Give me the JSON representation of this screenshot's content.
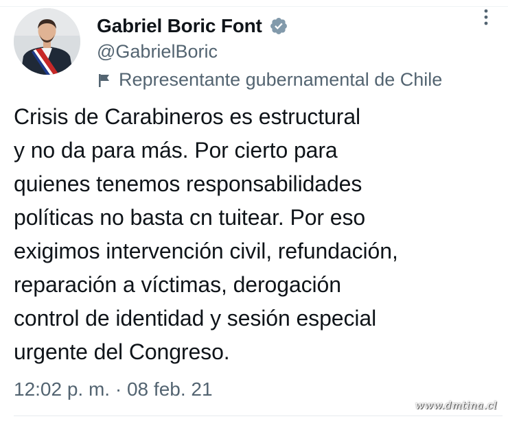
{
  "tweet": {
    "display_name": "Gabriel Boric Font",
    "handle": "@GabrielBoric",
    "affiliation_label": "Representante gubernamental de Chile",
    "text_lines": [
      "Crisis de Carabineros es estructural",
      "y no da para más. Por cierto para",
      "quienes tenemos responsabilidades",
      "políticas no basta cn tuitear. Por eso",
      "exigimos intervención civil, refundación,",
      "reparación a víctimas, derogación",
      "control de identidad y sesión especial",
      "urgente del Congreso."
    ],
    "time": "12:02 p. m.",
    "separator": " · ",
    "date": "08 feb. 21"
  },
  "icons": {
    "verified": "verified-badge-icon",
    "more": "more-vertical-icon",
    "label": "flag-icon"
  },
  "colors": {
    "text_primary": "#0f1419",
    "text_secondary": "#536471",
    "verified_badge": "#829aab"
  },
  "watermark": "www.dmtina.cl"
}
